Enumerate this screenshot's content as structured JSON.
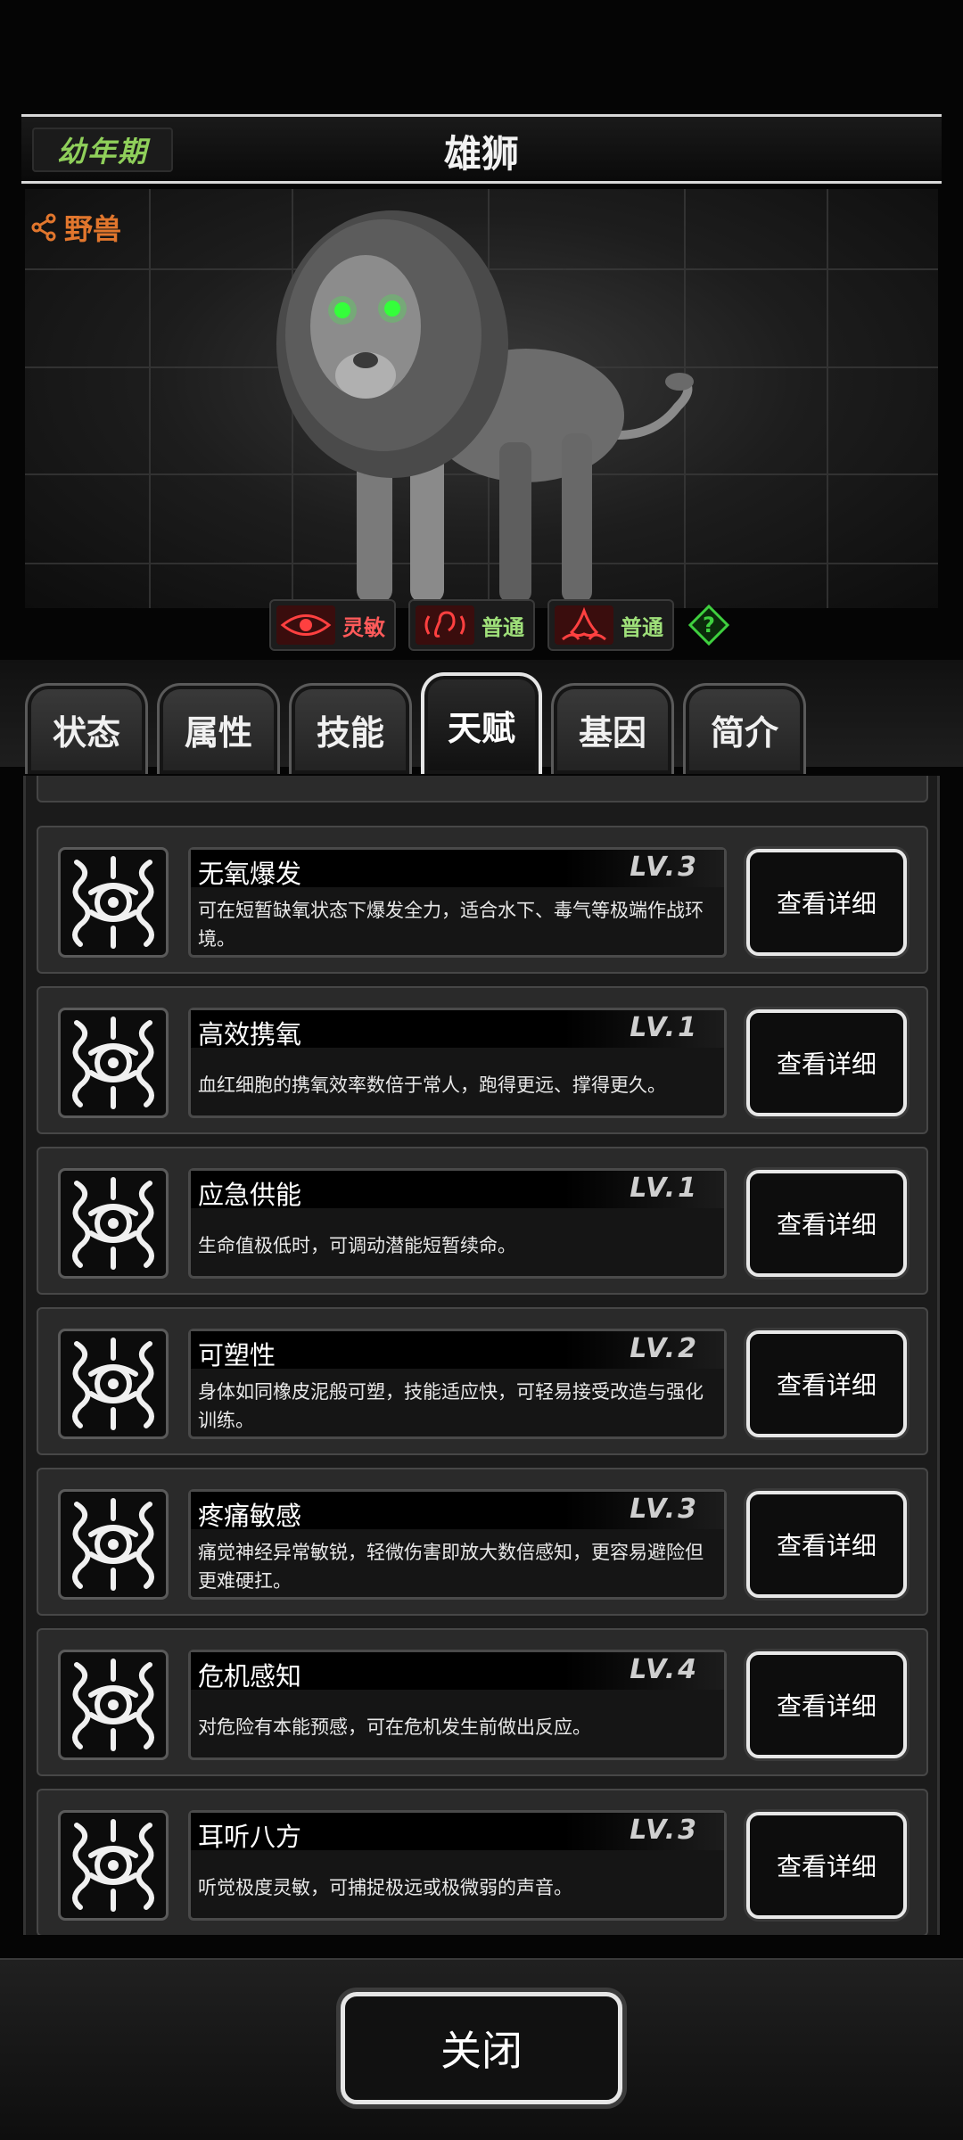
{
  "header": {
    "stage": "幼年期",
    "title": "雄狮"
  },
  "category": "野兽",
  "senses": [
    {
      "icon": "eye-icon",
      "label": "灵敏",
      "color": "#ff5a5a"
    },
    {
      "icon": "ear-icon",
      "label": "普通",
      "color": "#9fe07a"
    },
    {
      "icon": "nose-icon",
      "label": "普通",
      "color": "#9fe07a"
    }
  ],
  "tabs": [
    {
      "label": "状态",
      "active": false
    },
    {
      "label": "属性",
      "active": false
    },
    {
      "label": "技能",
      "active": false
    },
    {
      "label": "天赋",
      "active": true
    },
    {
      "label": "基因",
      "active": false
    },
    {
      "label": "简介",
      "active": false
    }
  ],
  "detail_label": "查看详细",
  "talents": [
    {
      "name": "无氧爆发",
      "level": "LV.3",
      "desc": "可在短暂缺氧状态下爆发全力，适合水下、毒气等极端作战环境。"
    },
    {
      "name": "高效携氧",
      "level": "LV.1",
      "desc": "血红细胞的携氧效率数倍于常人，跑得更远、撑得更久。"
    },
    {
      "name": "应急供能",
      "level": "LV.1",
      "desc": "生命值极低时，可调动潜能短暂续命。"
    },
    {
      "name": "可塑性",
      "level": "LV.2",
      "desc": "身体如同橡皮泥般可塑，技能适应快，可轻易接受改造与强化训练。"
    },
    {
      "name": "疼痛敏感",
      "level": "LV.3",
      "desc": "痛觉神经异常敏锐，轻微伤害即放大数倍感知，更容易避险但更难硬扛。"
    },
    {
      "name": "危机感知",
      "level": "LV.4",
      "desc": "对危险有本能预感，可在危机发生前做出反应。"
    },
    {
      "name": "耳听八方",
      "level": "LV.3",
      "desc": "听觉极度灵敏，可捕捉极远或极微弱的声音。"
    }
  ],
  "footer": {
    "close_label": "关闭"
  }
}
